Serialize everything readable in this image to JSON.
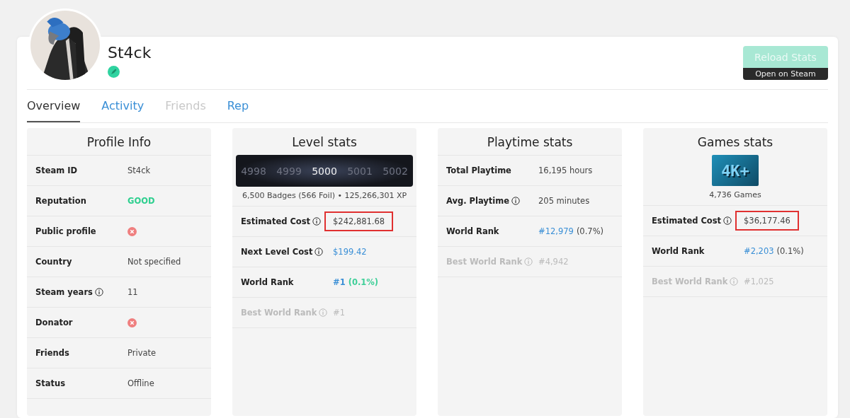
{
  "profile": {
    "name": "St4ck",
    "status_icon": true
  },
  "actions": {
    "primary": {
      "label": "Reload Stats",
      "disabled": true
    },
    "secondary": {
      "label": "Open on Steam"
    }
  },
  "tabs": [
    {
      "label": "Overview",
      "selected": true,
      "disabled": false
    },
    {
      "label": "Activity",
      "selected": false,
      "disabled": false
    },
    {
      "label": "Friends",
      "selected": false,
      "disabled": true
    },
    {
      "label": "Rep",
      "selected": false,
      "disabled": false
    }
  ],
  "panels": [
    {
      "title": "Profile Info",
      "rows": [
        {
          "label": "Steam ID",
          "info": false,
          "muted": false,
          "value": {
            "kind": "text",
            "text": "St4ck"
          }
        },
        {
          "label": "Reputation",
          "info": false,
          "muted": false,
          "value": {
            "kind": "good",
            "text": "GOOD"
          }
        },
        {
          "label": "Public profile",
          "info": false,
          "muted": false,
          "value": {
            "kind": "cross"
          }
        },
        {
          "label": "Country",
          "info": false,
          "muted": false,
          "value": {
            "kind": "text",
            "text": "Not specified"
          }
        },
        {
          "label": "Steam years",
          "info": true,
          "muted": false,
          "value": {
            "kind": "text",
            "text": "11"
          }
        },
        {
          "label": "Donator",
          "info": false,
          "muted": false,
          "value": {
            "kind": "cross"
          }
        },
        {
          "label": "Friends",
          "info": false,
          "muted": false,
          "value": {
            "kind": "text",
            "text": "Private"
          }
        },
        {
          "label": "Status",
          "info": false,
          "muted": false,
          "value": {
            "kind": "text",
            "text": "Offline"
          }
        }
      ]
    },
    {
      "title": "Level stats",
      "header": {
        "kind": "levels",
        "levels": [
          {
            "label": "4998",
            "selected": false
          },
          {
            "label": "4999",
            "selected": false
          },
          {
            "label": "5000",
            "selected": true
          },
          {
            "label": "5001",
            "selected": false
          },
          {
            "label": "5002",
            "selected": false
          }
        ],
        "caption": "6,500 Badges (566 Foil) • 125,266,301 XP"
      },
      "rows": [
        {
          "label": "Estimated Cost",
          "info": true,
          "muted": false,
          "value": {
            "kind": "text",
            "text": "$242,881.68",
            "highlighted": true
          }
        },
        {
          "label": "Next Level Cost",
          "info": true,
          "muted": false,
          "value": {
            "kind": "link",
            "text": "$199.42"
          }
        },
        {
          "label": "World Rank",
          "info": false,
          "muted": false,
          "value": {
            "kind": "rank",
            "rank": "#1",
            "share": "(0.1%)",
            "emphasized": true
          }
        },
        {
          "label": "Best World Rank",
          "info": true,
          "muted": true,
          "value": {
            "kind": "text",
            "text": "#1"
          }
        }
      ]
    },
    {
      "title": "Playtime stats",
      "rows": [
        {
          "label": "Total Playtime",
          "info": false,
          "muted": false,
          "value": {
            "kind": "text",
            "text": "16,195 hours"
          }
        },
        {
          "label": "Avg. Playtime",
          "info": true,
          "muted": false,
          "value": {
            "kind": "text",
            "text": "205 minutes"
          }
        },
        {
          "label": "World Rank",
          "info": false,
          "muted": false,
          "value": {
            "kind": "rank",
            "rank": "#12,979",
            "share": "(0.7%)",
            "emphasized": false
          }
        },
        {
          "label": "Best World Rank",
          "info": true,
          "muted": true,
          "value": {
            "kind": "text",
            "text": "#4,942"
          }
        }
      ]
    },
    {
      "title": "Games stats",
      "header": {
        "kind": "badge",
        "badge": "4K+",
        "caption": "4,736 Games"
      },
      "rows": [
        {
          "label": "Estimated Cost",
          "info": true,
          "muted": false,
          "value": {
            "kind": "text",
            "text": "$36,177.46",
            "highlighted": true
          }
        },
        {
          "label": "World Rank",
          "info": false,
          "muted": false,
          "value": {
            "kind": "rank",
            "rank": "#2,203",
            "share": "(0.1%)",
            "emphasized": false
          }
        },
        {
          "label": "Best World Rank",
          "info": true,
          "muted": true,
          "value": {
            "kind": "text",
            "text": "#1,025"
          }
        }
      ]
    }
  ]
}
